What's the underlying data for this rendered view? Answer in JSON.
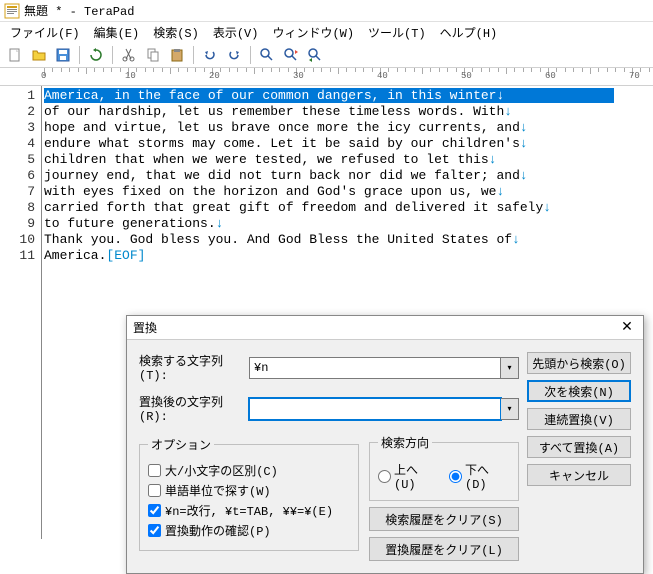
{
  "window": {
    "title": "無題 * - TeraPad"
  },
  "menu": {
    "file": "ファイル(F)",
    "edit": "編集(E)",
    "search": "検索(S)",
    "view": "表示(V)",
    "window": "ウィンドウ(W)",
    "tool": "ツール(T)",
    "help": "ヘルプ(H)"
  },
  "ruler": {
    "marks": [
      "0",
      "10",
      "20",
      "30",
      "40",
      "50",
      "60",
      "70"
    ]
  },
  "lines": [
    "America, in the face of our common dangers, in this winter",
    "of our hardship, let us remember these timeless words. With",
    "hope and virtue, let us brave once more the icy currents, and",
    "endure what storms may come. Let it be said by our children's",
    "children that when we were tested, we refused to let this",
    "journey end, that we did not turn back nor did we falter; and",
    "with eyes fixed on the horizon and God's grace upon us, we",
    "carried forth that great gift of freedom and delivered it safely",
    "to future generations.",
    "Thank you. God bless you. And God Bless the United States of",
    "America."
  ],
  "eof": "[EOF]",
  "newline": "↓",
  "dialog": {
    "title": "置換",
    "search_label": "検索する文字列(T):",
    "replace_label": "置換後の文字列(R):",
    "search_value": "¥n",
    "replace_value": "",
    "options_legend": "オプション",
    "opt_case": "大/小文字の区別(C)",
    "opt_word": "単語単位で探す(W)",
    "opt_escape": "¥n=改行, ¥t=TAB, ¥¥=¥(E)",
    "opt_confirm": "置換動作の確認(P)",
    "direction_legend": "検索方向",
    "dir_up": "上へ(U)",
    "dir_down": "下へ(D)",
    "btn_top": "先頭から検索(O)",
    "btn_next": "次を検索(N)",
    "btn_cont": "連続置換(V)",
    "btn_all": "すべて置換(A)",
    "btn_cancel": "キャンセル",
    "btn_clear_search": "検索履歴をクリア(S)",
    "btn_clear_replace": "置換履歴をクリア(L)"
  }
}
